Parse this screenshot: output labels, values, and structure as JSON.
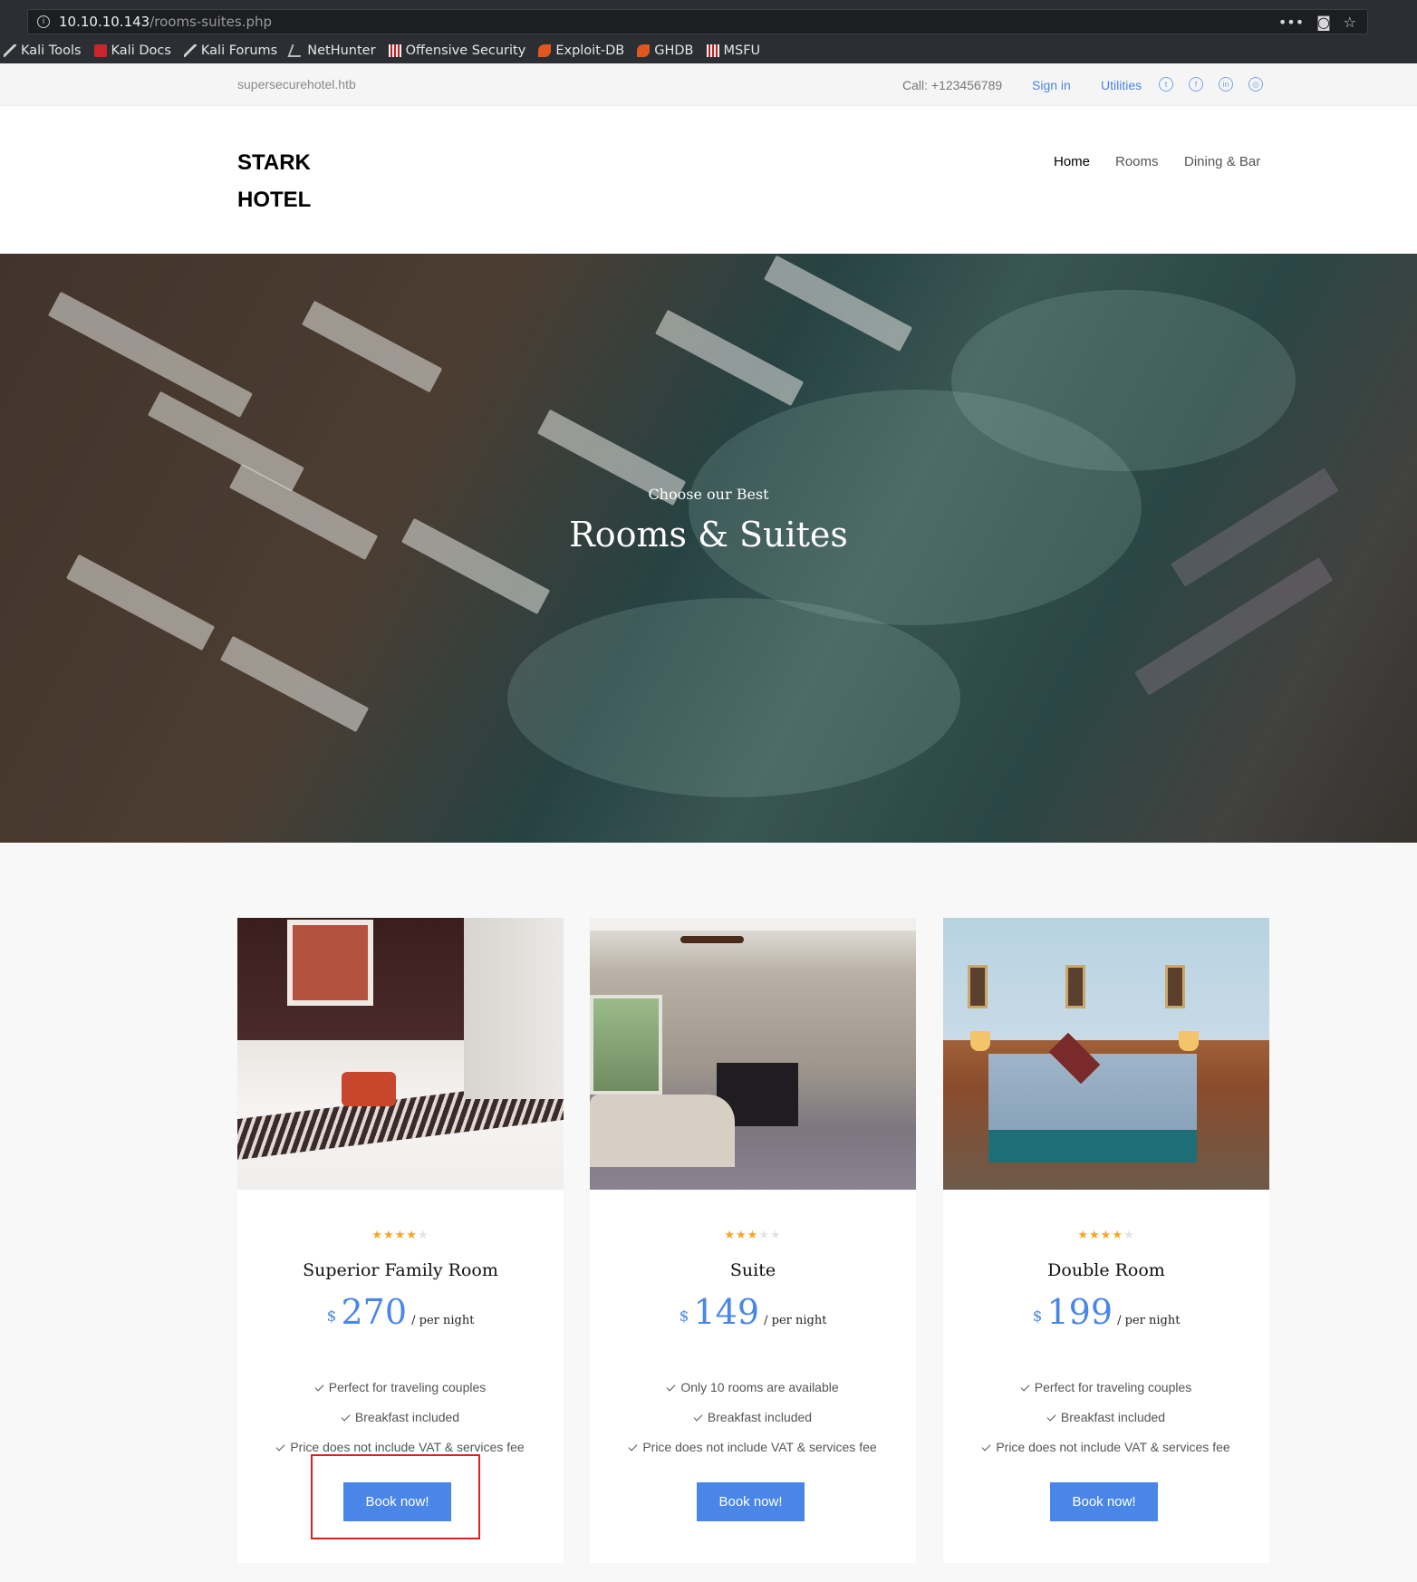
{
  "browser": {
    "url_host": "10.10.10.143",
    "url_path": "/rooms-suites.php",
    "bookmarks": [
      "Kali Tools",
      "Kali Docs",
      "Kali Forums",
      "NetHunter",
      "Offensive Security",
      "Exploit-DB",
      "GHDB",
      "MSFU"
    ]
  },
  "topbar": {
    "domain": "supersecurehotel.htb",
    "call": "Call: +123456789",
    "signin": "Sign in",
    "utilities": "Utilities"
  },
  "header": {
    "logo_line1": "STARK",
    "logo_line2": "HOTEL",
    "nav": [
      "Home",
      "Rooms",
      "Dining & Bar"
    ]
  },
  "hero": {
    "subtitle": "Choose our Best",
    "title": "Rooms & Suites"
  },
  "rooms": [
    {
      "stars": 4,
      "name": "Superior Family Room",
      "currency": "$",
      "price": "270",
      "per": "/ per night",
      "features": [
        "Perfect for traveling couples",
        "Breakfast included",
        "Price does not include VAT & services fee"
      ],
      "button": "Book now!"
    },
    {
      "stars": 3,
      "name": "Suite",
      "currency": "$",
      "price": "149",
      "per": "/ per night",
      "features": [
        "Only 10 rooms are available",
        "Breakfast included",
        "Price does not include VAT & services fee"
      ],
      "button": "Book now!"
    },
    {
      "stars": 4,
      "name": "Double Room",
      "currency": "$",
      "price": "199",
      "per": "/ per night",
      "features": [
        "Perfect for traveling couples",
        "Breakfast included",
        "Price does not include VAT & services fee"
      ],
      "button": "Book now!"
    }
  ],
  "colors": {
    "accent": "#4a86e8",
    "star": "#f5a623",
    "highlight": "#e0201f"
  }
}
